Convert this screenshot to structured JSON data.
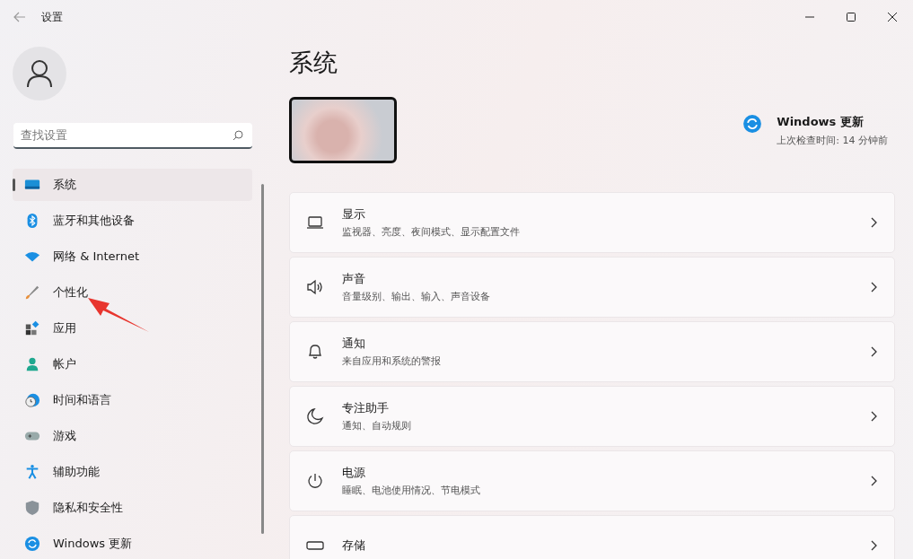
{
  "window": {
    "title": "设置"
  },
  "search": {
    "placeholder": "查找设置"
  },
  "sidebar": {
    "items": [
      {
        "label": "系统",
        "kind": "system",
        "selected": true
      },
      {
        "label": "蓝牙和其他设备",
        "kind": "bluetooth",
        "selected": false
      },
      {
        "label": "网络 & Internet",
        "kind": "network",
        "selected": false
      },
      {
        "label": "个性化",
        "kind": "brush",
        "selected": false
      },
      {
        "label": "应用",
        "kind": "apps",
        "selected": false
      },
      {
        "label": "帐户",
        "kind": "account",
        "selected": false
      },
      {
        "label": "时间和语言",
        "kind": "time",
        "selected": false
      },
      {
        "label": "游戏",
        "kind": "game",
        "selected": false
      },
      {
        "label": "辅助功能",
        "kind": "access",
        "selected": false
      },
      {
        "label": "隐私和安全性",
        "kind": "shield",
        "selected": false
      },
      {
        "label": "Windows 更新",
        "kind": "update",
        "selected": false
      }
    ]
  },
  "page": {
    "title": "系统",
    "update": {
      "title": "Windows 更新",
      "subtitle": "上次检查时间: 14 分钟前"
    }
  },
  "settings": [
    {
      "title": "显示",
      "subtitle": "监视器、亮度、夜间模式、显示配置文件",
      "kind": "display"
    },
    {
      "title": "声音",
      "subtitle": "音量级别、输出、输入、声音设备",
      "kind": "sound"
    },
    {
      "title": "通知",
      "subtitle": "来自应用和系统的警报",
      "kind": "bell"
    },
    {
      "title": "专注助手",
      "subtitle": "通知、自动规则",
      "kind": "moon"
    },
    {
      "title": "电源",
      "subtitle": "睡眠、电池使用情况、节电模式",
      "kind": "power"
    },
    {
      "title": "存储",
      "kind": "storage"
    }
  ]
}
